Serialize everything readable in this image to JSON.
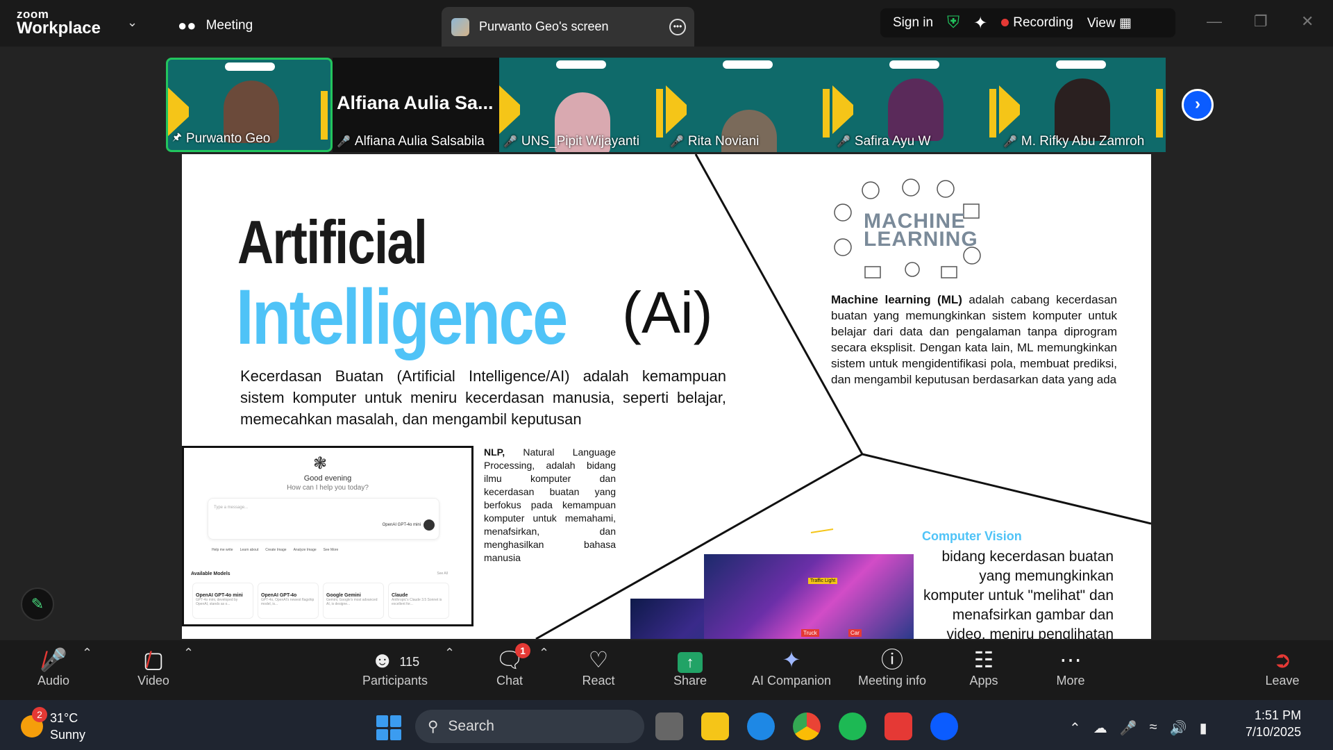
{
  "app": {
    "logo_small": "zoom",
    "logo_big": "Workplace",
    "meeting_tab": "Meeting",
    "share_tab": "Purwanto Geo's screen",
    "sign_in": "Sign in",
    "recording": "Recording",
    "view": "View"
  },
  "participants_strip": [
    {
      "name": "Purwanto Geo",
      "self": true
    },
    {
      "name": "Alfiana Aulia Salsabila",
      "big_name": "Alfiana Aulia Sa...",
      "muted": true
    },
    {
      "name": "UNS_Pipit Wijayanti",
      "muted": true
    },
    {
      "name": "Rita Noviani",
      "muted": true
    },
    {
      "name": "Safira Ayu W",
      "muted": true
    },
    {
      "name": "M. Rifky Abu Zamroh",
      "muted": true
    }
  ],
  "slide": {
    "title_line1": "Artificial",
    "title_line2": "Intelligence",
    "title_suffix": "(Ai)",
    "ai_description": "Kecerdasan Buatan (Artificial Intelligence/AI) adalah kemampuan sistem komputer untuk meniru kecerdasan manusia, seperti belajar, memecahkan masalah, dan mengambil keputusan",
    "nlp_bold": "NLP,",
    "nlp_text": " Natural Language Processing, adalah bidang ilmu komputer dan kecerdasan buatan yang berfokus pada kemampuan komputer untuk memahami, menafsirkan, dan menghasilkan bahasa manusia",
    "ml_title1": "MACHINE",
    "ml_title2": "LEARNING",
    "ml_bold": "Machine learning (ML)",
    "ml_text": " adalah cabang kecerdasan buatan yang memungkinkan sistem komputer untuk belajar dari data dan pengalaman tanpa diprogram secara eksplisit. Dengan kata lain, ML memungkinkan sistem untuk mengidentifikasi pola, membuat prediksi, dan mengambil keputusan berdasarkan data yang ada",
    "cv_title": "Computer Vision",
    "cv_text": "bidang kecerdasan buatan yang memungkinkan komputer untuk \"melihat\" dan menafsirkan gambar dan video, meniru penglihatan manusia",
    "chat_shot": {
      "greeting": "Good evening",
      "ask": "How can I help you today?",
      "placeholder": "Type a message...",
      "model": "OpenAI GPT-4o mini",
      "chips": [
        "Help me write",
        "Learn about",
        "Create Image",
        "Analyze Image",
        "See More"
      ],
      "available": "Available Models",
      "see_all": "See All",
      "cards": [
        {
          "name": "OpenAI GPT-4o mini",
          "desc": "GPT-4o mini, developed by OpenAI, stands as o..."
        },
        {
          "name": "OpenAI GPT-4o",
          "desc": "GPT-4o, OpenAI's newest flagship model, is..."
        },
        {
          "name": "Google Gemini",
          "desc": "Gemini, Google's most advanced AI, is designe..."
        },
        {
          "name": "Claude",
          "desc": "Anthropic's Claude 3.5 Sonnet is excellent for..."
        }
      ]
    },
    "cv_tags": [
      "Car",
      "Truck",
      "Traffic Light"
    ]
  },
  "toolbar": {
    "audio": "Audio",
    "video": "Video",
    "participants": "Participants",
    "participants_count": "115",
    "chat": "Chat",
    "chat_badge": "1",
    "react": "React",
    "share": "Share",
    "ai_companion": "AI Companion",
    "meeting_info": "Meeting info",
    "apps": "Apps",
    "more": "More",
    "leave": "Leave"
  },
  "taskbar": {
    "temp": "31°C",
    "weather": "Sunny",
    "weather_badge": "2",
    "search": "Search",
    "time": "1:51 PM",
    "date": "7/10/2025"
  },
  "colors": {
    "accent_blue": "#4fc3f7",
    "zoom_blue": "#0b5cff",
    "record_red": "#e53935",
    "share_green": "#21a366"
  }
}
